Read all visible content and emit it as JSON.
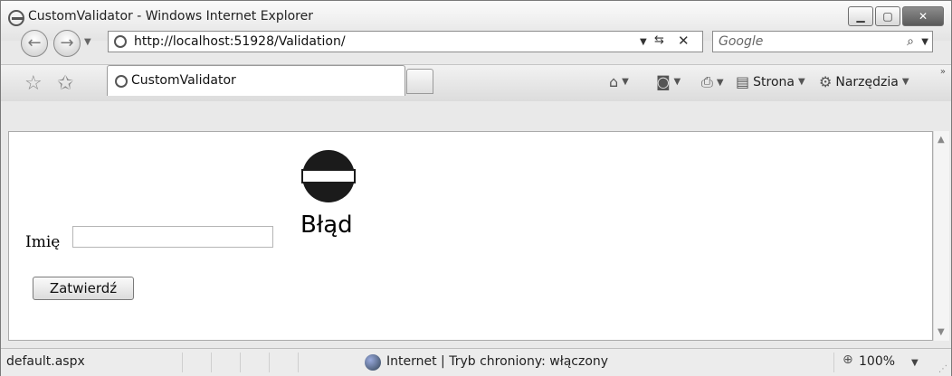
{
  "window": {
    "title": "CustomValidator - Windows Internet Explorer"
  },
  "addressbar": {
    "url": "http://localhost:51928/Validation/"
  },
  "search": {
    "placeholder": "Google"
  },
  "tab": {
    "label": "CustomValidator"
  },
  "commands": {
    "page_label": "Strona",
    "tools_label": "Narzędzia"
  },
  "form": {
    "field_label": "Imię",
    "field_value": "",
    "error_text": "Błąd",
    "submit_label": "Zatwierdź"
  },
  "statusbar": {
    "left_text": "default.aspx",
    "zone_text": "Internet | Tryb chroniony: włączony",
    "zoom_text": "100%"
  }
}
